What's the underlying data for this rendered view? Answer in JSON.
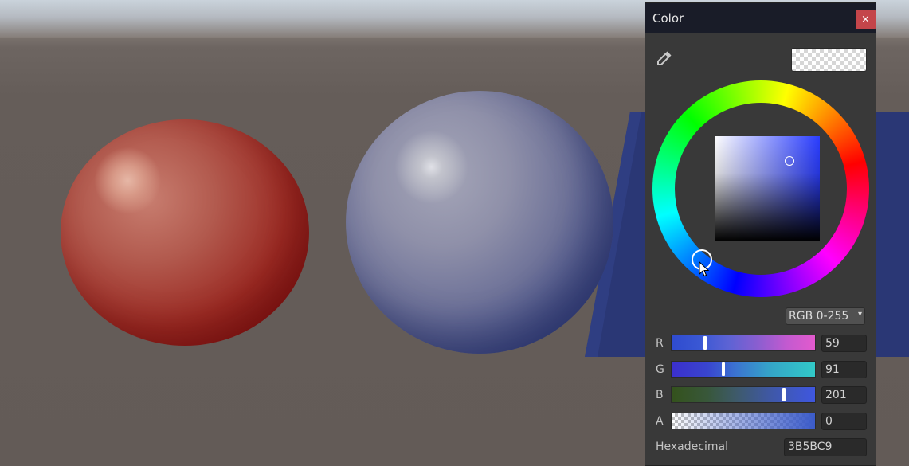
{
  "window": {
    "title": "Color",
    "close_icon": "×"
  },
  "picker": {
    "eyedropper_icon": "eyedropper-icon",
    "mode": "RGB 0-255",
    "mode_arrow": "▾",
    "channels": [
      {
        "label": "R",
        "value": "59",
        "fraction": 0.23
      },
      {
        "label": "G",
        "value": "91",
        "fraction": 0.36
      },
      {
        "label": "B",
        "value": "201",
        "fraction": 0.79
      },
      {
        "label": "A",
        "value": "0",
        "fraction": 0.0
      }
    ],
    "hex_label": "Hexadecimal",
    "hex_value": "3B5BC9"
  },
  "colors": {
    "current": "#3B5BC9",
    "panel_bg": "#393939",
    "titlebar_bg": "#191C28",
    "close_bg": "#C4454A"
  }
}
